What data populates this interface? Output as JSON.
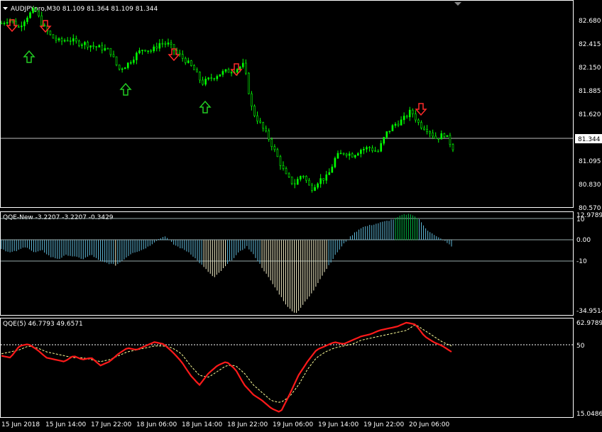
{
  "colors": {
    "background": "#000000",
    "grid": "#ffffff",
    "bull_candle": "#00ff00",
    "bear_candle": "#00ff00",
    "sell_arrow": "#ff2a2a",
    "buy_arrow": "#22cc22",
    "hist_main": "#5fb9d9",
    "hist_low": "#f4f0c8",
    "hist_high": "#00bb44",
    "qqe_line": "#ff1a1a",
    "qqe_signal": "#ffff99"
  },
  "main_panel": {
    "title": "AUDJPYpro,M30  81.109 81.364 81.109 81.344",
    "price_labels": [
      "82.680",
      "82.415",
      "82.150",
      "81.885",
      "81.620",
      "81.344",
      "81.095",
      "80.830",
      "80.570"
    ],
    "current_price": "81.344"
  },
  "qqe_new_panel": {
    "title": "QQE-New -3.2207 -3.2207 -0.3429",
    "labels": [
      "12.9789",
      "10",
      "0.00",
      "-10",
      "-34.9514"
    ]
  },
  "qqe_panel": {
    "title": "QQE(5) 46.7793 49.6571",
    "labels": [
      "62.9789",
      "50",
      "15.0486"
    ]
  },
  "time_labels": [
    "15 Jun 2018",
    "15 Jun 14:00",
    "17 Jun 22:00",
    "18 Jun 06:00",
    "18 Jun 14:00",
    "18 Jun 22:00",
    "19 Jun 06:00",
    "19 Jun 14:00",
    "19 Jun 22:00",
    "20 Jun 06:00"
  ],
  "chart_data": [
    {
      "type": "candlestick",
      "title": "AUDJPYpro,M30",
      "ylim": [
        80.57,
        82.78
      ],
      "close_path": [
        82.55,
        82.6,
        82.5,
        82.62,
        82.7,
        82.52,
        82.4,
        82.35,
        82.38,
        82.34,
        82.33,
        82.3,
        82.28,
        82.25,
        82.05,
        82.1,
        82.2,
        82.28,
        82.25,
        82.34,
        82.32,
        82.22,
        82.15,
        82.05,
        81.9,
        81.95,
        82.0,
        82.03,
        82.05,
        82.1,
        81.6,
        81.45,
        81.3,
        81.1,
        80.9,
        80.8,
        80.92,
        80.75,
        80.85,
        80.88,
        81.1,
        81.15,
        81.12,
        81.18,
        81.2,
        81.15,
        81.35,
        81.45,
        81.5,
        81.6,
        81.45,
        81.4,
        81.3,
        81.35,
        81.2
      ]
    },
    {
      "type": "bar",
      "title": "QQE-New",
      "ylim": [
        -34.9514,
        12.9789
      ],
      "values_path": [
        -4,
        -6,
        -5,
        -3,
        -6,
        -5,
        -8,
        -9,
        -7,
        -8,
        -9,
        -7,
        -10,
        -11,
        -12,
        -9,
        -6,
        -5,
        -3,
        0,
        2,
        -2,
        -4,
        -6,
        -10,
        -14,
        -18,
        -14,
        -10,
        -6,
        -3,
        -8,
        -14,
        -20,
        -26,
        -32,
        -35,
        -30,
        -25,
        -18,
        -12,
        -6,
        -1,
        3,
        6,
        7,
        8,
        9,
        10,
        12,
        12.5,
        10,
        5,
        2,
        0,
        -3
      ]
    },
    {
      "type": "line",
      "title": "QQE(5)",
      "ylim": [
        15.0486,
        62.9789
      ],
      "series": [
        {
          "name": "QQE",
          "values": [
            45,
            44,
            50,
            51,
            48,
            44,
            43,
            42,
            45,
            43,
            44,
            40,
            42,
            46,
            49,
            48,
            50,
            52,
            51,
            47,
            42,
            35,
            30,
            36,
            40,
            42,
            38,
            30,
            25,
            22,
            18,
            16,
            25,
            35,
            42,
            48,
            50,
            52,
            51,
            53,
            55,
            56,
            58,
            59,
            60,
            62,
            61,
            55,
            52,
            50,
            47
          ]
        },
        {
          "name": "Signal",
          "values": [
            46,
            47,
            48,
            50,
            49,
            47,
            46,
            45,
            44,
            44,
            43,
            42,
            43,
            45,
            47,
            48,
            49,
            50,
            50,
            49,
            46,
            40,
            35,
            34,
            37,
            40,
            40,
            36,
            30,
            26,
            22,
            21,
            24,
            30,
            38,
            44,
            47,
            49,
            50,
            51,
            53,
            54,
            55,
            56,
            57,
            58,
            61,
            58,
            55,
            52,
            50
          ]
        }
      ]
    }
  ]
}
